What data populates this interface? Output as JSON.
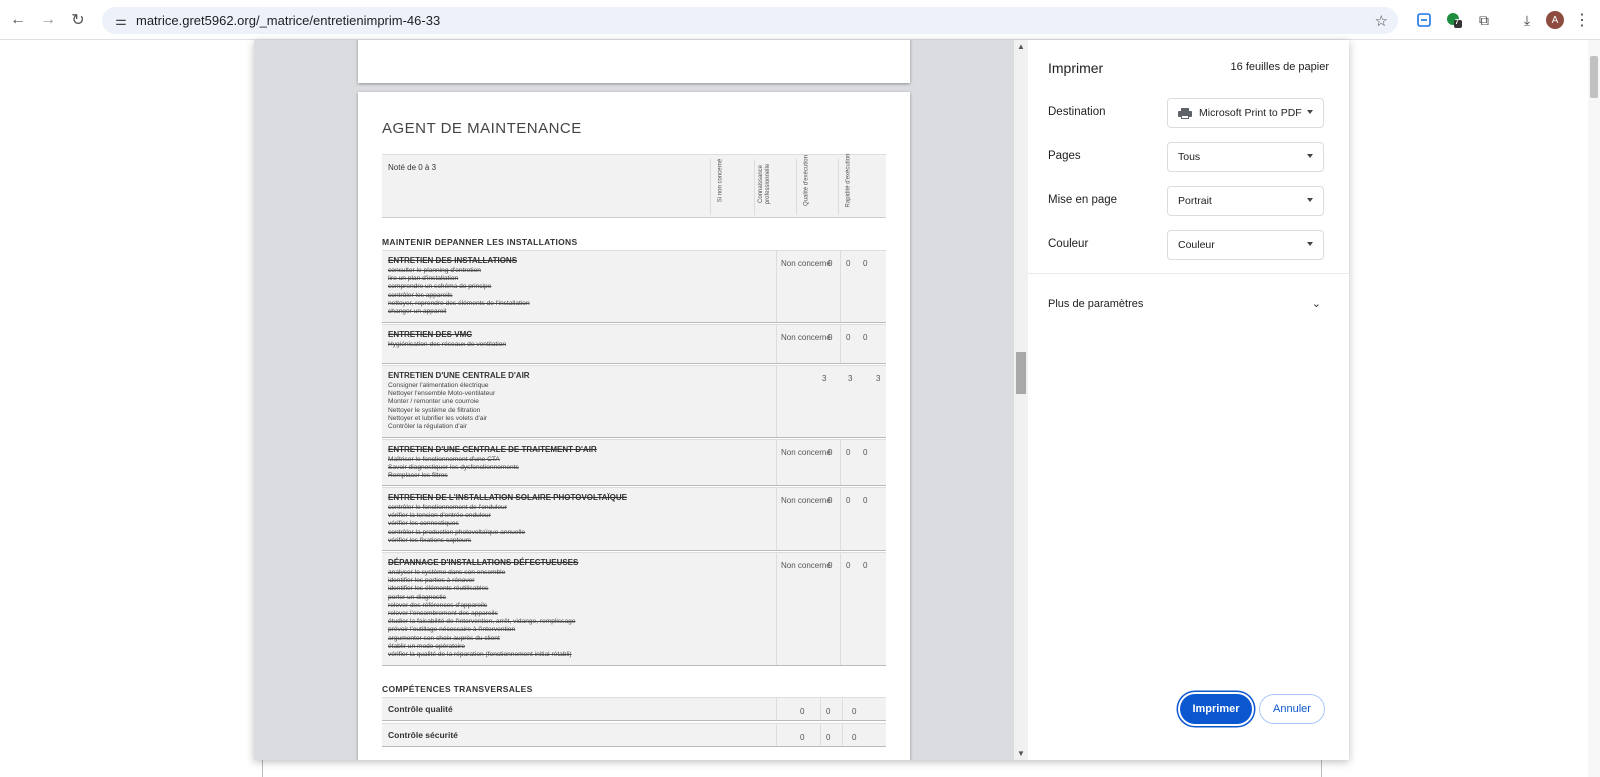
{
  "browser": {
    "url": "matrice.gret5962.org/_matrice/entretienimprim-46-33",
    "profile_initial": "A",
    "extension_badge": "7"
  },
  "document": {
    "title": "AGENT DE MAINTENANCE",
    "scale_note": "Noté de 0 à 3",
    "column_headers": [
      "Si non concerné",
      "Connaissance professionnelle",
      "Qualité d'exécution",
      "Rapidité d'exécution"
    ],
    "section1": "MAINTENIR DEPANNER LES INSTALLATIONS",
    "section2": "COMPÉTENCES TRANSVERSALES",
    "rows": [
      {
        "title": "ENTRETIEN DES INSTALLATIONS",
        "tasks": "consulter le planning d'entretien\nlire un plan d'installation\ncomprendre un schéma de principe\ncontrôler les appareils\nnettoyer, reprendre des éléments de l'installation\nchanger un appareil",
        "status": "Non concerné",
        "v1": "0",
        "v2": "0",
        "v3": "0"
      },
      {
        "title": "ENTRETIEN DES VMC",
        "tasks": "Hygiénisation des réseaux de ventilation",
        "status": "Non concerné",
        "v1": "0",
        "v2": "0",
        "v3": "0"
      },
      {
        "title": "ENTRETIEN D'UNE CENTRALE D'AIR",
        "tasks": "Consigner l'alimentation électrique\nNettoyer l'ensemble Moto-ventilateur\nMonter / remonter une courroie\nNettoyer le système de filtration\nNettoyer et lubrifier les volets d'air\nContrôler la régulation d'air",
        "status": "",
        "v1": "3",
        "v2": "3",
        "v3": "3"
      },
      {
        "title": "ENTRETIEN D'UNE CENTRALE DE TRAITEMENT D'AIR",
        "tasks": "Maîtriser le fonctionnement d'une CTA\nSavoir diagnostiquer les dysfonctionnements\nRemplacer les filtres",
        "status": "Non concerné",
        "v1": "0",
        "v2": "0",
        "v3": "0"
      },
      {
        "title": "ENTRETIEN DE L'INSTALLATION SOLAIRE PHOTOVOLTAÏQUE",
        "tasks": "contrôler le fonctionnement de l'onduleur\nvérifier la tension d'entrée onduleur\nvérifier les connectiques\ncontrôler la production photovoltaïque annuelle\nvérifier les fixations capteurs",
        "status": "Non concerné",
        "v1": "0",
        "v2": "0",
        "v3": "0"
      },
      {
        "title": "DÉPANNAGE D'INSTALLATIONS DÉFECTUEUSES",
        "tasks": "analyser le système dans son ensemble\nidentifier les parties à rénover\nidentifier les éléments réutilisables\nporter un diagnostic\nrelever des références d'appareils\nrelever l'encombrement des appareils\nétudier la faisabilité de l'intervention, arrêt, vidange, remplissage\nprévoir l'outillage nécessaire à l'intervention\nargumenter son choix auprès du client\nétablir un mode opératoire\nvérifier la qualité de la réparation (fonctionnement initial rétabli)",
        "status": "Non concerné",
        "v1": "0",
        "v2": "0",
        "v3": "0"
      }
    ],
    "transversal": [
      {
        "title": "Contrôle qualité",
        "v1": "0",
        "v2": "0",
        "v3": "0"
      },
      {
        "title": "Contrôle sécurité",
        "v1": "0",
        "v2": "0",
        "v3": "0"
      }
    ]
  },
  "print": {
    "title": "Imprimer",
    "sheets": "16 feuilles de papier",
    "destination_label": "Destination",
    "destination_value": "Microsoft Print to PDF",
    "pages_label": "Pages",
    "pages_value": "Tous",
    "layout_label": "Mise en page",
    "layout_value": "Portrait",
    "color_label": "Couleur",
    "color_value": "Couleur",
    "more_settings": "Plus de paramètres",
    "print_button": "Imprimer",
    "cancel_button": "Annuler"
  }
}
